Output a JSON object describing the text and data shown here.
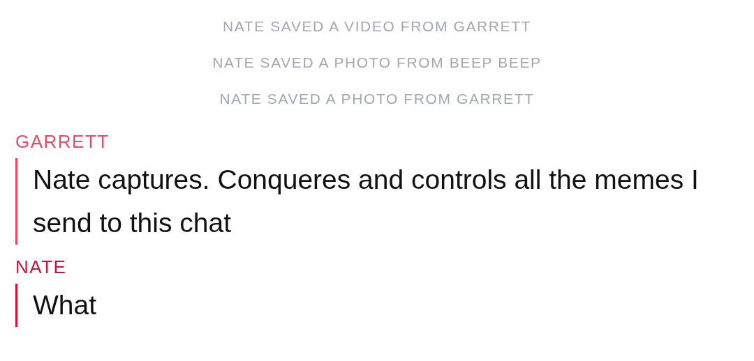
{
  "system_notes": [
    "NATE SAVED A VIDEO FROM GARRETT",
    "NATE SAVED A PHOTO FROM BEEP BEEP",
    "NATE SAVED A PHOTO FROM GARRETT"
  ],
  "messages": [
    {
      "sender": "GARRETT",
      "color": "#e84a65",
      "text": "Nate captures. Conqueres and controls all the memes I send to this chat"
    },
    {
      "sender": "NATE",
      "color": "#d0133c",
      "text": "What"
    }
  ]
}
